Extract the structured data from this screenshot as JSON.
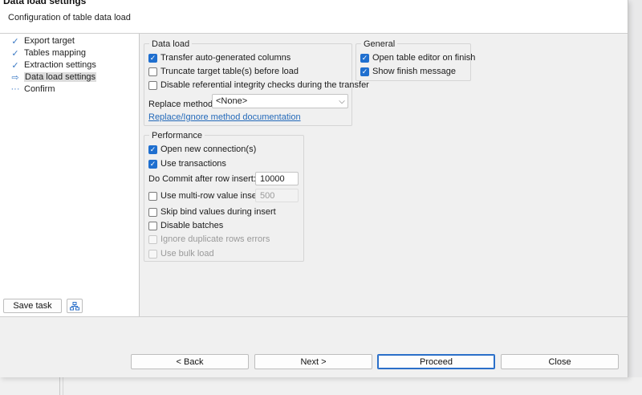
{
  "header": {
    "title": "Data load settings",
    "subtitle": "Configuration of table data load"
  },
  "nav": {
    "items": [
      {
        "label": "Export target",
        "icon": "check-icon",
        "state": "done"
      },
      {
        "label": "Tables mapping",
        "icon": "check-icon",
        "state": "done"
      },
      {
        "label": "Extraction settings",
        "icon": "check-icon",
        "state": "done"
      },
      {
        "label": "Data load settings",
        "icon": "arrow-right-icon",
        "state": "current"
      },
      {
        "label": "Confirm",
        "icon": "ellipsis-icon",
        "state": "pending"
      }
    ],
    "save_task_label": "Save task"
  },
  "data_load": {
    "legend": "Data load",
    "transfer_auto_columns": {
      "label": "Transfer auto-generated columns",
      "checked": true
    },
    "truncate_target": {
      "label": "Truncate target table(s) before load",
      "checked": false
    },
    "disable_ref_integrity": {
      "label": "Disable referential integrity checks during the transfer",
      "checked": false
    },
    "replace_method_label": "Replace method:",
    "replace_method_value": "<None>",
    "doc_link": "Replace/Ignore method documentation"
  },
  "general": {
    "legend": "General",
    "open_table_editor": {
      "label": "Open table editor on finish",
      "checked": true
    },
    "show_finish_message": {
      "label": "Show finish message",
      "checked": true
    }
  },
  "performance": {
    "legend": "Performance",
    "open_new_connection": {
      "label": "Open new connection(s)",
      "checked": true
    },
    "use_transactions": {
      "label": "Use transactions",
      "checked": true
    },
    "commit_label": "Do Commit after row insert:",
    "commit_value": "10000",
    "multi_row": {
      "label": "Use multi-row value insert",
      "checked": false
    },
    "multi_row_value": "500",
    "skip_bind": {
      "label": "Skip bind values during insert",
      "checked": false
    },
    "disable_batches": {
      "label": "Disable batches",
      "checked": false
    },
    "ignore_duplicates": {
      "label": "Ignore duplicate rows errors",
      "checked": false,
      "disabled": true
    },
    "use_bulk_load": {
      "label": "Use bulk load",
      "checked": false,
      "disabled": true
    }
  },
  "buttons": {
    "back": "< Back",
    "next": "Next >",
    "proceed": "Proceed",
    "close": "Close"
  },
  "colors": {
    "accent": "#1f6fcf",
    "link": "#2369b9"
  }
}
